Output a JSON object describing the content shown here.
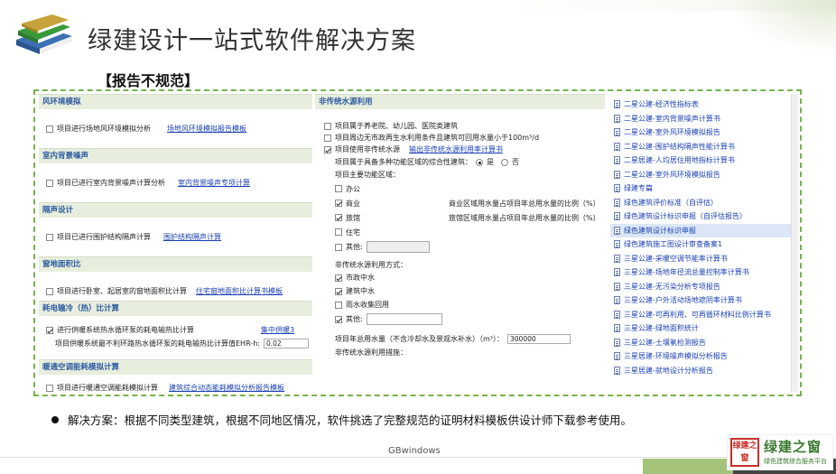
{
  "title": "绿建设计一站式软件解决方案",
  "subtitle": "【报告不规范】",
  "panel1": {
    "sections": [
      {
        "header": "风环境模拟",
        "rows": [
          {
            "checked": false,
            "label": "项目进行场地风环境模拟分析",
            "link": "场地风环境模拟报告模板"
          }
        ]
      },
      {
        "header": "室内背景噪声",
        "rows": [
          {
            "checked": false,
            "label": "项目已进行室内背景噪声计算分析",
            "link": "室内背景噪声专项计算"
          }
        ]
      },
      {
        "header": "隔声设计",
        "rows": [
          {
            "checked": false,
            "label": "项目已进行围护结构隔声计算",
            "link": "围护结构隔声计算"
          }
        ]
      },
      {
        "header": "窗地面积比",
        "rows": [
          {
            "checked": false,
            "label": "项目进行卧室、起居室的窗地面积比计算",
            "link": "住宅窗地面积比计算书模板"
          }
        ]
      }
    ],
    "hvac1": {
      "header": "耗电输冷（热）比计算",
      "row1_label": "进行供暖系统热水循环泵的耗电输热比计算",
      "row1_link": "集中供暖3",
      "row2_label": "项目供暖系统最不利环路热水循环泵的耗电输热比计算值EHR-h:",
      "row2_value": "0.02"
    },
    "hvac2": {
      "header": "暖通空调能耗模拟计算",
      "row_label": "项目进行暖通空调能耗模拟计算",
      "row_link": "建筑综合动态能耗模拟分析报告模板"
    }
  },
  "panel2": {
    "header": "非传统水源利用",
    "items": [
      {
        "checked": false,
        "label": "项目属于养老院、幼儿园、医院类建筑"
      },
      {
        "checked": false,
        "label": "项目周边无市政再生水利用条件且建筑可回用水量小于100m³/d"
      },
      {
        "checked": true,
        "label": "项目使用非传统水源",
        "link": "输出非传统水源利用率计算书"
      }
    ],
    "multi_label": "项目属于具备多种功能区域的综合性建筑：",
    "yes": "是",
    "no": "否",
    "main_area_label": "项目主要功能区域：",
    "areas": [
      {
        "checked": false,
        "label": "办公",
        "note": ""
      },
      {
        "checked": true,
        "label": "商业",
        "note": "商业区域用水量占项目年总用水量的比例（%）"
      },
      {
        "checked": true,
        "label": "旅馆",
        "note": "旅馆区域用水量占项目年总用水量的比例（%）"
      },
      {
        "checked": false,
        "label": "住宅",
        "note": ""
      },
      {
        "checked": false,
        "label": "其他:",
        "note": ""
      }
    ],
    "source_label": "非传统水源利用方式：",
    "sources": [
      {
        "checked": true,
        "label": "市政中水"
      },
      {
        "checked": true,
        "label": "建筑中水"
      },
      {
        "checked": false,
        "label": "雨水收集回用"
      },
      {
        "checked": true,
        "label": "其他:"
      }
    ],
    "annual_label": "项目年总用水量（不含冷却水及景观水补水）（m³）：",
    "annual_value": "300000",
    "measures_label": "非传统水源利用措施："
  },
  "panel3": {
    "items": [
      "二星公建-经济性指标表",
      "二星公建-室内背景噪声计算书",
      "二星公建-室外风环境模拟报告",
      "二星公建-围护结构隔声性能计算书",
      "二星居建-人均居住用地指标计算书",
      "二星公建-室外风环境模拟报告",
      "绿建专篇",
      "绿色建筑评价标准（自评估）",
      "绿色建筑设计标识申报（自评估报告）",
      "绿色建筑设计标识申报",
      "绿色建筑施工图设计审查备案1",
      "三星公建-采暖空调节能率计算书",
      "三星公建-场地年径流总量控制率计算书",
      "三星公建-无污染分析专项报告",
      "三星公建-户外活动场地遮阴率计算书",
      "三星公建-可再利用、可再循环材料比例计算书",
      "三星公建-绿地面积统计",
      "三星公建-土壤氡检测报告",
      "三星居建-环境噪声模拟分析报告",
      "三星居建-就地设计分析报告"
    ],
    "selected_index": 9
  },
  "bullet": "解决方案：根据不同类型建筑，根据不同地区情况，软件挑选了完整规范的证明材料模板供设计师下载参考使用。",
  "footer": "GBwindows",
  "logo": {
    "text": "绿建之窗",
    "stamp": "绿建之窗",
    "sub": "绿色建筑综合服务平台"
  }
}
